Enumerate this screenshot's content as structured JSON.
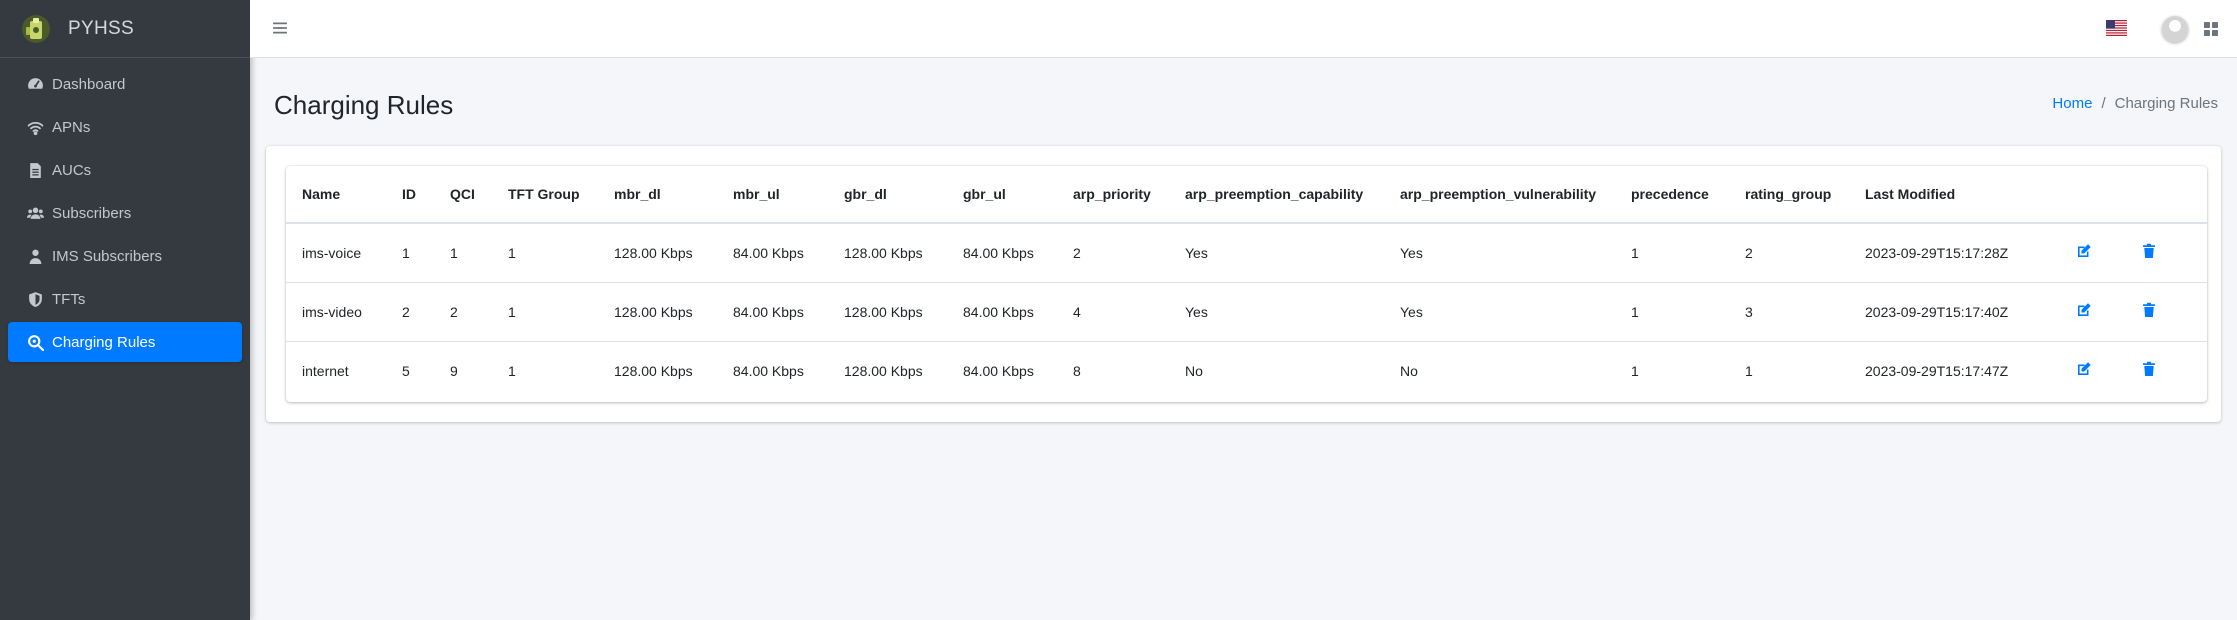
{
  "brand": {
    "name": "PYHSS",
    "logo_icon": "pyhss-logo-icon"
  },
  "sidebar": {
    "items": [
      {
        "label": "Dashboard",
        "icon": "tachometer-icon",
        "active": false
      },
      {
        "label": "APNs",
        "icon": "wifi-icon",
        "active": false
      },
      {
        "label": "AUCs",
        "icon": "file-icon",
        "active": false
      },
      {
        "label": "Subscribers",
        "icon": "users-icon",
        "active": false
      },
      {
        "label": "IMS Subscribers",
        "icon": "user-icon",
        "active": false
      },
      {
        "label": "TFTs",
        "icon": "shield-icon",
        "active": false
      },
      {
        "label": "Charging Rules",
        "icon": "search-icon",
        "active": true
      }
    ]
  },
  "topbar": {
    "menu_icon": "hamburger-icon",
    "flag_icon": "us-flag-icon",
    "avatar_icon": "avatar-icon",
    "apps_icon": "grid-icon"
  },
  "page": {
    "title": "Charging Rules"
  },
  "breadcrumb": {
    "home": "Home",
    "separator": "/",
    "current": "Charging Rules"
  },
  "table": {
    "columns": [
      "Name",
      "ID",
      "QCI",
      "TFT Group",
      "mbr_dl",
      "mbr_ul",
      "gbr_dl",
      "gbr_ul",
      "arp_priority",
      "arp_preemption_capability",
      "arp_preemption_vulnerability",
      "precedence",
      "rating_group",
      "Last Modified"
    ],
    "rows": [
      [
        "ims-voice",
        "1",
        "1",
        "1",
        "128.00 Kbps",
        "84.00 Kbps",
        "128.00 Kbps",
        "84.00 Kbps",
        "2",
        "Yes",
        "Yes",
        "1",
        "2",
        "2023-09-29T15:17:28Z"
      ],
      [
        "ims-video",
        "2",
        "2",
        "1",
        "128.00 Kbps",
        "84.00 Kbps",
        "128.00 Kbps",
        "84.00 Kbps",
        "4",
        "Yes",
        "Yes",
        "1",
        "3",
        "2023-09-29T15:17:40Z"
      ],
      [
        "internet",
        "5",
        "9",
        "1",
        "128.00 Kbps",
        "84.00 Kbps",
        "128.00 Kbps",
        "84.00 Kbps",
        "8",
        "No",
        "No",
        "1",
        "1",
        "2023-09-29T15:17:47Z"
      ]
    ],
    "row_actions": {
      "edit_icon": "edit-icon",
      "delete_icon": "trash-icon"
    }
  },
  "colors": {
    "sidebar_bg": "#343a40",
    "accent": "#007bff",
    "content_bg": "#f4f6f9"
  }
}
